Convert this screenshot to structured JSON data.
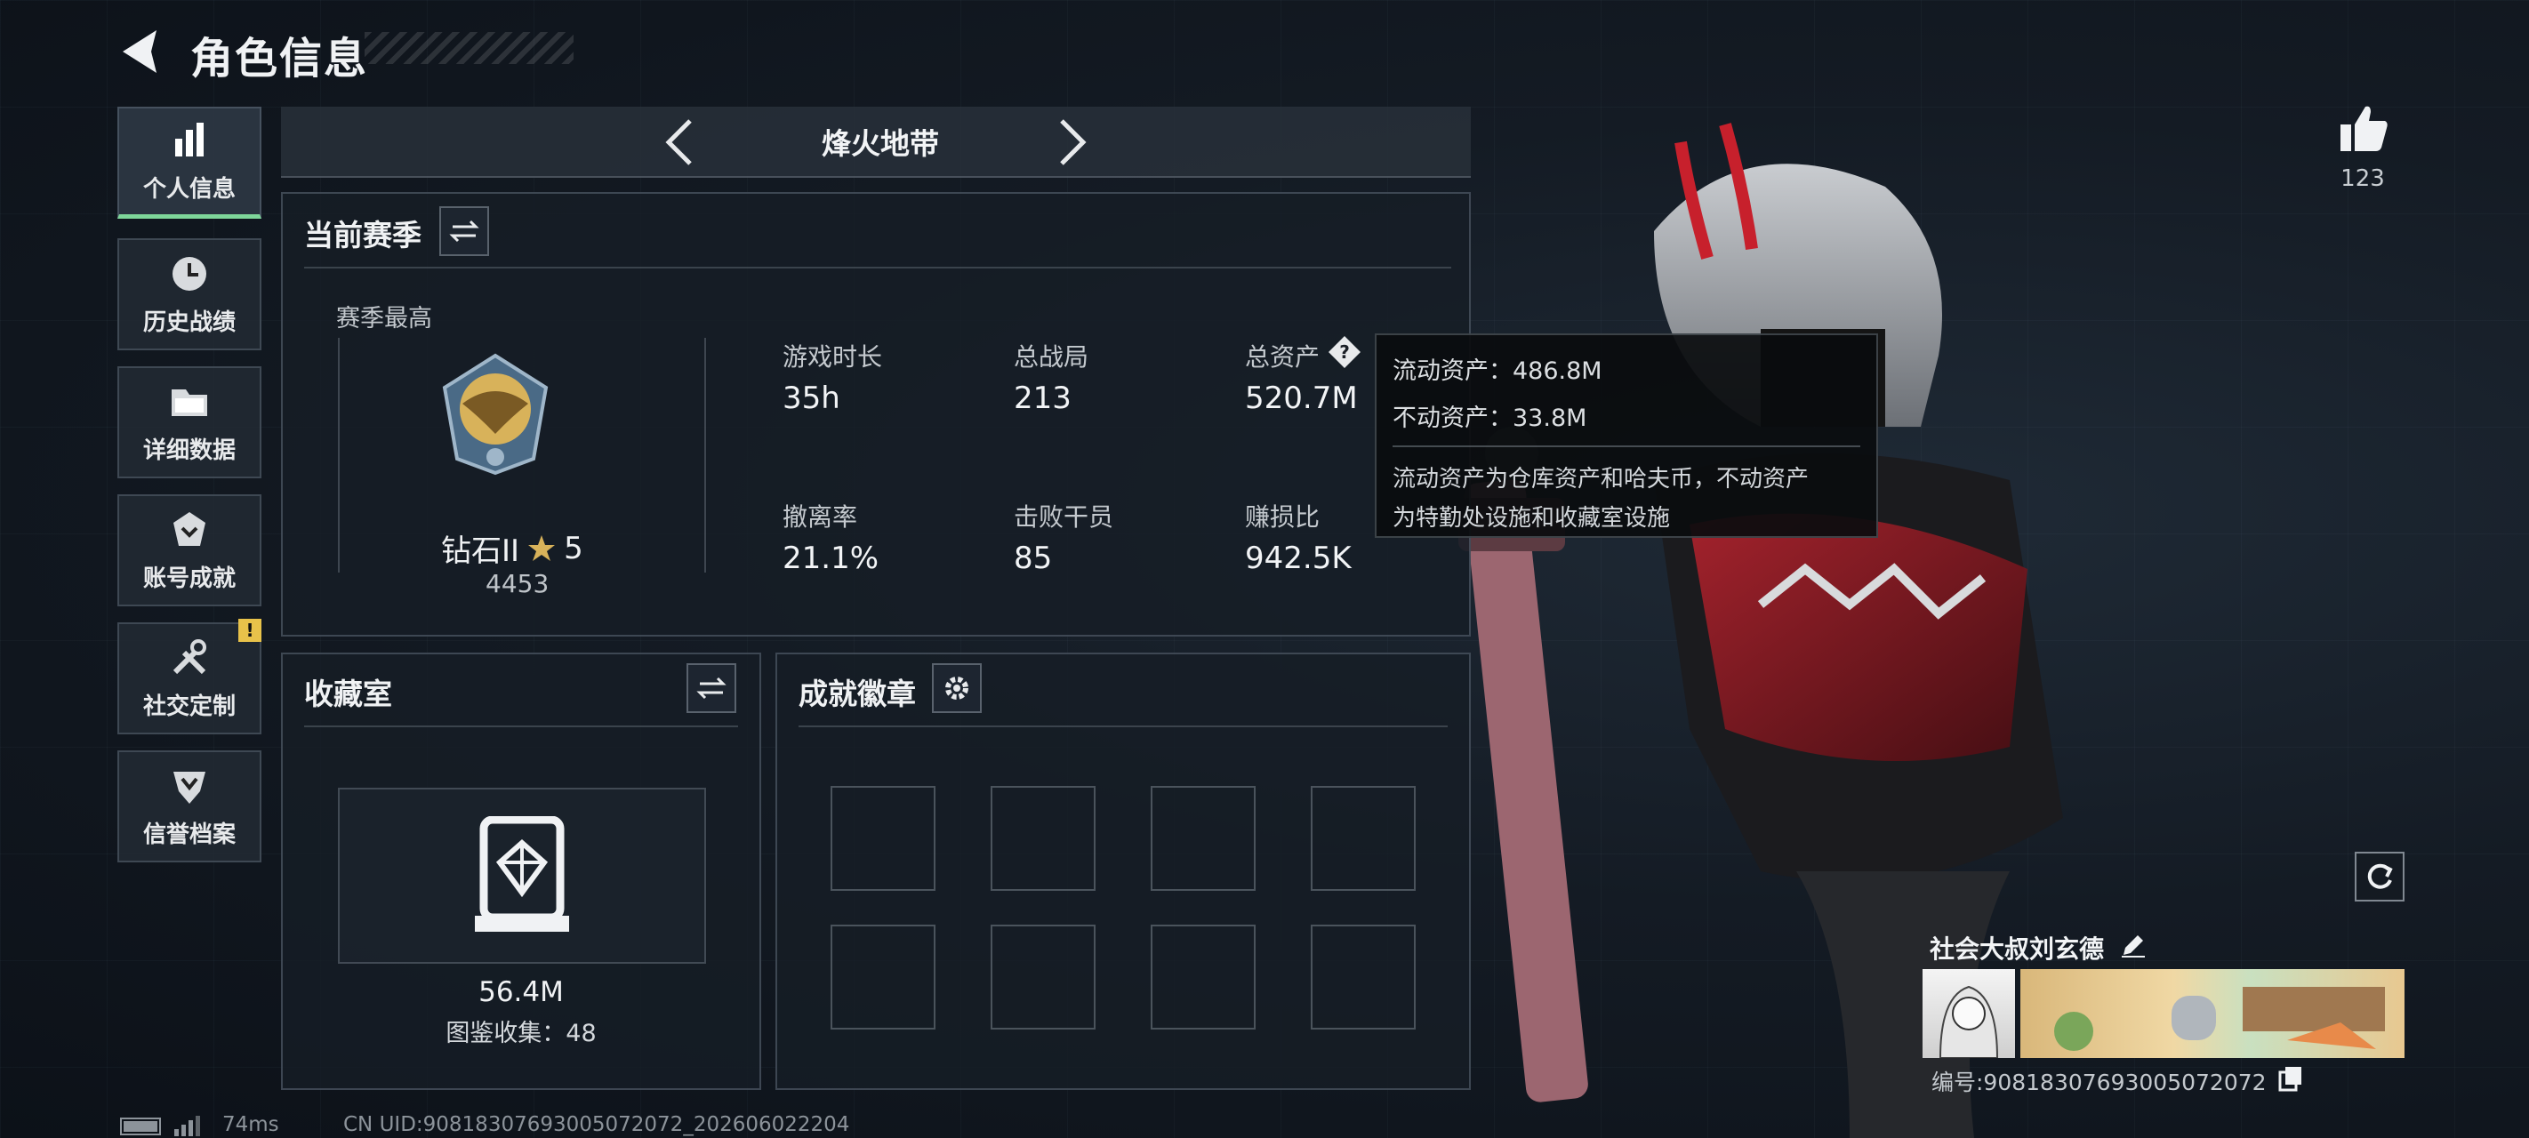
{
  "header": {
    "title": "角色信息"
  },
  "sidebar": {
    "items": [
      {
        "label": "个人信息",
        "icon": "bar-chart-icon",
        "active": true
      },
      {
        "label": "历史战绩",
        "icon": "clock-icon",
        "active": false
      },
      {
        "label": "详细数据",
        "icon": "folder-icon",
        "active": false
      },
      {
        "label": "账号成就",
        "icon": "achievement-icon",
        "active": false
      },
      {
        "label": "社交定制",
        "icon": "tools-icon",
        "active": false,
        "badge": "!"
      },
      {
        "label": "信誉档案",
        "icon": "shield-badge-icon",
        "active": false
      }
    ]
  },
  "mode_selector": {
    "title": "烽火地带"
  },
  "season_panel": {
    "title": "当前赛季",
    "best_label": "赛季最高",
    "rank_name": "钻石II",
    "rank_stars": "5",
    "rank_score": "4453",
    "stats": [
      {
        "label": "游戏时长",
        "value": "35h"
      },
      {
        "label": "总战局",
        "value": "213"
      },
      {
        "label": "总资产",
        "value": "520.7M"
      },
      {
        "label": "撤离率",
        "value": "21.1%"
      },
      {
        "label": "击败干员",
        "value": "85"
      },
      {
        "label": "赚损比",
        "value": "942.5K"
      }
    ]
  },
  "tooltip": {
    "liquid": "流动资产：486.8M",
    "fixed": "不动资产：33.8M",
    "desc_line1": "流动资产为仓库资产和哈夫币，不动资产",
    "desc_line2": "为特勤处设施和收藏室设施"
  },
  "collection_panel": {
    "title": "收藏室",
    "value": "56.4M",
    "catalog": "图鉴收集：48"
  },
  "achievement_panel": {
    "title": "成就徽章"
  },
  "social": {
    "like_count": "123",
    "player_name": "社会大叔刘玄德",
    "player_id": "编号:9081830769300507207​2"
  },
  "status_bar": {
    "ping": "74ms",
    "uid": "CN UID:9081830769300507207​2_202606022204"
  },
  "colors": {
    "accent_green": "#7ed69a",
    "warn_yellow": "#e8c24a",
    "rank_gold": "#d8b25a"
  }
}
